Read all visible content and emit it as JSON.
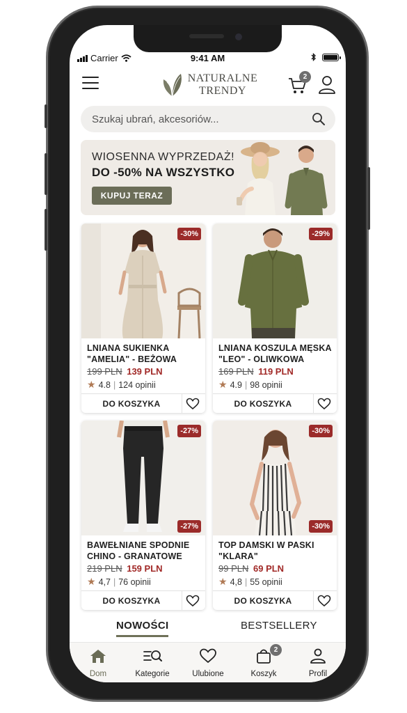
{
  "status_bar": {
    "carrier": "Carrier",
    "time": "9:41 AM"
  },
  "header": {
    "logo_line1": "NATURALNE",
    "logo_line2": "TRENDY",
    "cart_count": "2"
  },
  "search": {
    "placeholder": "Szukaj ubrań, akcesoriów..."
  },
  "banner": {
    "line1": "WIOSENNA WYPRZEDAŻ!",
    "line2": "DO -50% NA WSZYSTKO",
    "cta": "KUPUJ TERAZ"
  },
  "products": [
    {
      "name": "LNIANA SUKIENKA \"AMELIA\" - BEŻOWA",
      "old_price": "199 PLN",
      "new_price": "139 PLN",
      "rating": "4.8",
      "reviews": "124 opinii",
      "discount": "-30%",
      "add_label": "DO KOSZYKA"
    },
    {
      "name": "LNIANA KOSZULA MĘSKA \"LEO\" - OLIWKOWA",
      "old_price": "169 PLN",
      "new_price": "119 PLN",
      "rating": "4.9",
      "reviews": "98 opinii",
      "discount": "-29%",
      "add_label": "DO KOSZYKA"
    },
    {
      "name": "BAWEŁNIANE SPODNIE CHINO - GRANATOWE",
      "old_price": "219 PLN",
      "new_price": "159 PLN",
      "rating": "4,7",
      "reviews": "76 opinii",
      "discount": "-27%",
      "add_label": "DO KOSZYKA"
    },
    {
      "name": "TOP DAMSKI W PASKI \"KLARA\"",
      "old_price": "99 PLN",
      "new_price": "69 PLN",
      "rating": "4,8",
      "reviews": "55 opinii",
      "discount": "-30%",
      "add_label": "DO KOSZYKA"
    }
  ],
  "tabs": [
    "NOWOŚCI",
    "BESTSELLERY"
  ],
  "bottom_nav": {
    "items": [
      "Dom",
      "Kategorie",
      "Ulubione",
      "Koszyk",
      "Profil"
    ],
    "cart_count": "2"
  },
  "colors": {
    "accent": "#6b6d58",
    "sale_red": "#9b2b2a",
    "banner_bg": "#efebe6",
    "star": "#b07a55"
  }
}
